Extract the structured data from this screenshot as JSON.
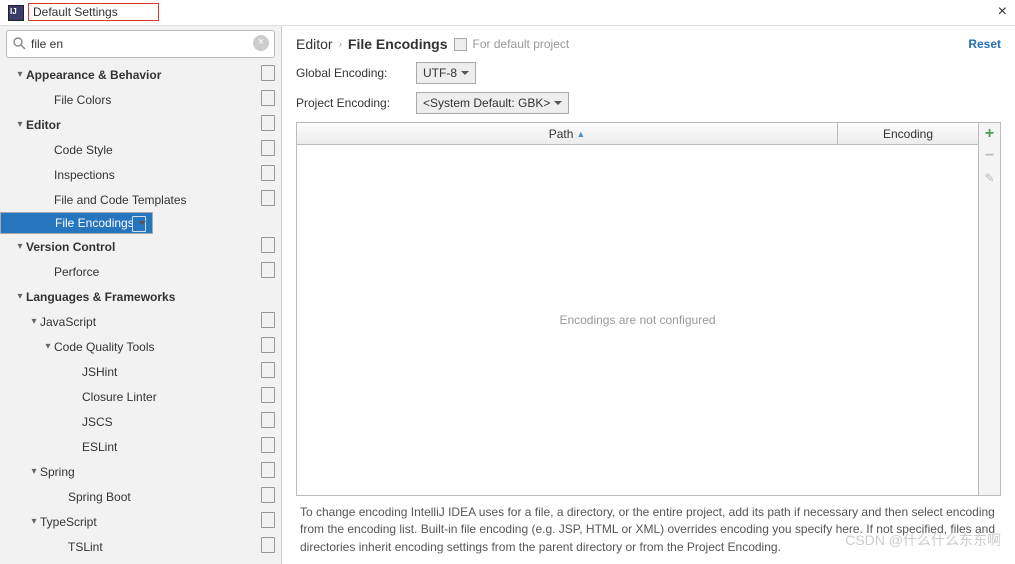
{
  "window": {
    "title": "Default Settings"
  },
  "search": {
    "value": "file en",
    "placeholder": ""
  },
  "sidebar": {
    "items": [
      {
        "label": "Appearance & Behavior",
        "indent": 0,
        "bold": true,
        "arrow": "down",
        "copy": true
      },
      {
        "label": "File Colors",
        "indent": 2,
        "bold": false,
        "arrow": "",
        "copy": true
      },
      {
        "label": "Editor",
        "indent": 0,
        "bold": true,
        "arrow": "down",
        "copy": true
      },
      {
        "label": "Code Style",
        "indent": 2,
        "bold": false,
        "arrow": "",
        "copy": true
      },
      {
        "label": "Inspections",
        "indent": 2,
        "bold": false,
        "arrow": "",
        "copy": true
      },
      {
        "label": "File and Code Templates",
        "indent": 2,
        "bold": false,
        "arrow": "",
        "copy": true
      },
      {
        "label": "File Encodings",
        "indent": 2,
        "bold": false,
        "arrow": "",
        "copy": true,
        "selected": true
      },
      {
        "label": "Version Control",
        "indent": 0,
        "bold": true,
        "arrow": "down",
        "copy": true
      },
      {
        "label": "Perforce",
        "indent": 2,
        "bold": false,
        "arrow": "",
        "copy": true
      },
      {
        "label": "Languages & Frameworks",
        "indent": 0,
        "bold": true,
        "arrow": "down",
        "copy": false
      },
      {
        "label": "JavaScript",
        "indent": 1,
        "bold": false,
        "arrow": "down",
        "copy": true
      },
      {
        "label": "Code Quality Tools",
        "indent": 2,
        "bold": false,
        "arrow": "down",
        "copy": true
      },
      {
        "label": "JSHint",
        "indent": 4,
        "bold": false,
        "arrow": "",
        "copy": true
      },
      {
        "label": "Closure Linter",
        "indent": 4,
        "bold": false,
        "arrow": "",
        "copy": true
      },
      {
        "label": "JSCS",
        "indent": 4,
        "bold": false,
        "arrow": "",
        "copy": true
      },
      {
        "label": "ESLint",
        "indent": 4,
        "bold": false,
        "arrow": "",
        "copy": true
      },
      {
        "label": "Spring",
        "indent": 1,
        "bold": false,
        "arrow": "down",
        "copy": true
      },
      {
        "label": "Spring Boot",
        "indent": 3,
        "bold": false,
        "arrow": "",
        "copy": true
      },
      {
        "label": "TypeScript",
        "indent": 1,
        "bold": false,
        "arrow": "down",
        "copy": true
      },
      {
        "label": "TSLint",
        "indent": 3,
        "bold": false,
        "arrow": "",
        "copy": true
      }
    ]
  },
  "breadcrumb": {
    "part1": "Editor",
    "part2": "File Encodings",
    "hint": "For default project",
    "reset": "Reset"
  },
  "form": {
    "global_label": "Global Encoding:",
    "global_value": "UTF-8",
    "project_label": "Project Encoding:",
    "project_value": "<System Default: GBK>"
  },
  "table": {
    "col_path": "Path",
    "col_enc": "Encoding",
    "empty": "Encodings are not configured"
  },
  "help": "To change encoding IntelliJ IDEA uses for a file, a directory, or the entire project, add its path if necessary and then select encoding from the encoding list. Built-in file encoding (e.g. JSP, HTML or XML) overrides encoding you specify here. If not specified, files and directories inherit encoding settings from the parent directory or from the Project Encoding.",
  "watermark": "CSDN @什么什么东东啊"
}
